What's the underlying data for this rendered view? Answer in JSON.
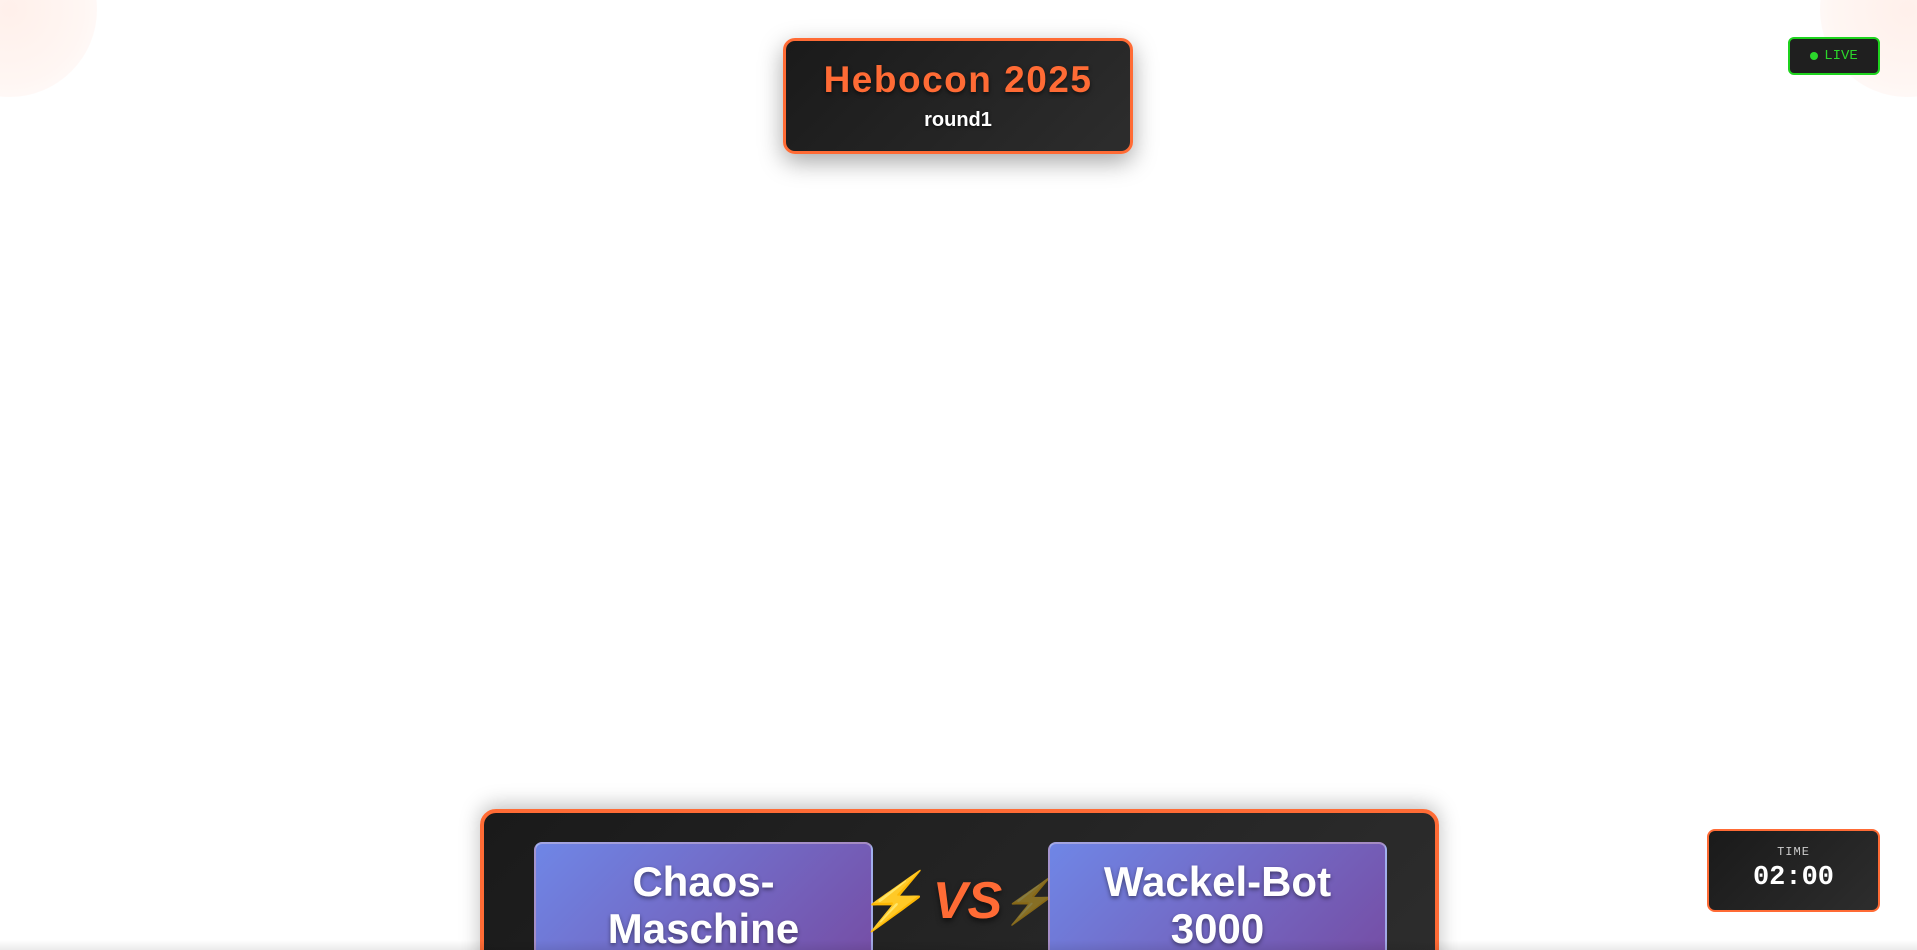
{
  "event": {
    "title": "Hebocon 2025",
    "round": "round1"
  },
  "status": {
    "live_label": "LIVE",
    "live_color": "#2bd62b"
  },
  "match": {
    "team_left": "Chaos-\nMaschine",
    "team_right": "Wackel-Bot\n3000",
    "vs_label": "VS",
    "bolt_icon": "lightning-bolt-icon"
  },
  "timer": {
    "label": "TIME",
    "value": "02:00"
  },
  "colors": {
    "accent": "#ff6b35",
    "panel_dark": "#1a1a1a",
    "team_gradient_start": "#6f86e6",
    "team_gradient_end": "#764ba2"
  }
}
